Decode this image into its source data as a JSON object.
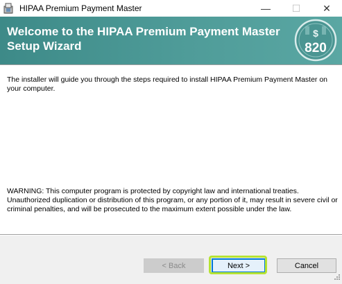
{
  "window": {
    "title": "HIPAA Premium Payment Master",
    "minimize_glyph": "—",
    "maximize_glyph": "☐",
    "close_glyph": "✕"
  },
  "banner": {
    "title": "Welcome to the HIPAA Premium Payment Master\nSetup Wizard",
    "badge_symbol": "$",
    "badge_text": "820",
    "colors": {
      "banner": "#4f9c99",
      "badge": "#4a9592"
    }
  },
  "content": {
    "intro": "The installer will guide you through the steps required to install HIPAA Premium Payment Master on your computer.",
    "warning": "WARNING: This computer program is protected by copyright law and international treaties. Unauthorized duplication or distribution of this program, or any portion of it, may result in severe civil or criminal penalties, and will be prosecuted to the maximum extent possible under the law."
  },
  "buttons": {
    "back": "< Back",
    "next": "Next >",
    "cancel": "Cancel"
  },
  "icons": {
    "app": "installer-icon",
    "badge": "edi-820-badge-icon"
  }
}
